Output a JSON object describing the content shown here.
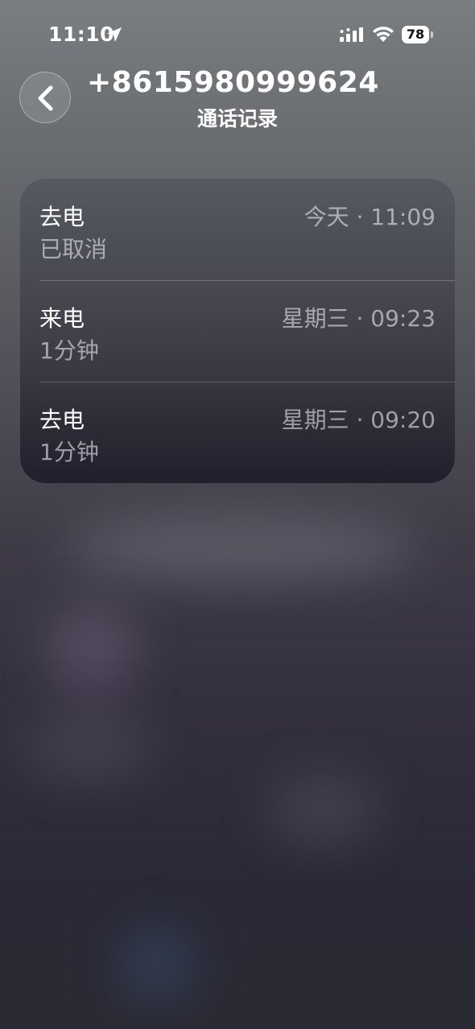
{
  "status_bar": {
    "time": "11:10",
    "battery": "78"
  },
  "header": {
    "phone_number": "+8615980999624",
    "subtitle": "通话记录"
  },
  "calls": [
    {
      "type": "去电",
      "detail": "已取消",
      "time": "今天 · 11:09"
    },
    {
      "type": "来电",
      "detail": "1分钟",
      "time": "星期三 · 09:23"
    },
    {
      "type": "去电",
      "detail": "1分钟",
      "time": "星期三 · 09:20"
    }
  ],
  "icons": {
    "location": "location-arrow-icon",
    "signal": "cellular-signal-icon",
    "wifi": "wifi-icon",
    "back": "chevron-left-icon"
  }
}
